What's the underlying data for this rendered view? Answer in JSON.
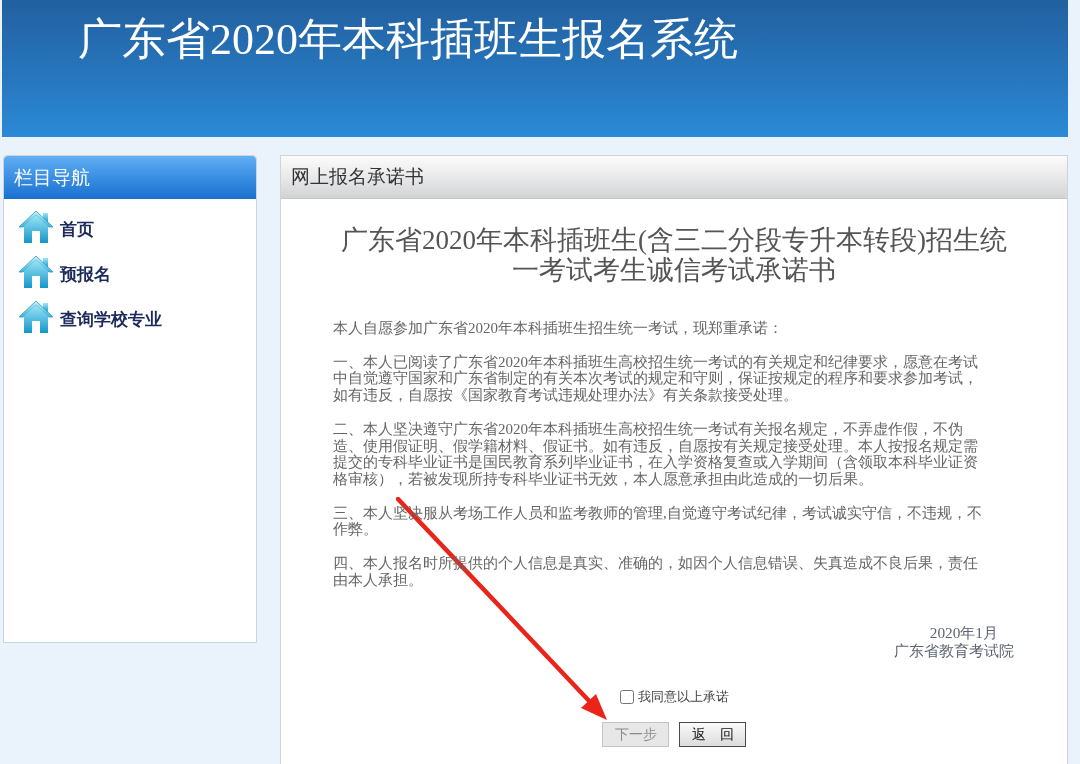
{
  "header": {
    "title": "广东省2020年本科插班生报名系统"
  },
  "sidebar": {
    "title": "栏目导航",
    "items": [
      {
        "label": "首页"
      },
      {
        "label": "预报名"
      },
      {
        "label": "查询学校专业"
      }
    ]
  },
  "panel": {
    "title": "网上报名承诺书",
    "document": {
      "title": "广东省2020年本科插班生(含三二分段专升本转段)招生统一考试考生诚信考试承诺书",
      "intro": "本人自愿参加广东省2020年本科插班生招生统一考试，现郑重承诺：",
      "clauses": [
        "一、本人已阅读了广东省2020年本科插班生高校招生统一考试的有关规定和纪律要求，愿意在考试中自觉遵守国家和广东省制定的有关本次考试的规定和守则，保证按规定的程序和要求参加考试，如有违反，自愿按《国家教育考试违规处理办法》有关条款接受处理。",
        "二、本人坚决遵守广东省2020年本科插班生高校招生统一考试有关报名规定，不弄虚作假，不伪造、使用假证明、假学籍材料、假证书。如有违反，自愿按有关规定接受处理。本人按报名规定需提交的专科毕业证书是国民教育系列毕业证书，在入学资格复查或入学期间（含领取本科毕业证资格审核），若被发现所持专科毕业证书无效，本人愿意承担由此造成的一切后果。",
        "三、本人坚决服从考场工作人员和监考教师的管理,自觉遵守考试纪律，考试诚实守信，不违规，不作弊。",
        "四、本人报名时所提供的个人信息是真实、准确的，如因个人信息错误、失真造成不良后果，责任由本人承担。"
      ],
      "date": "2020年1月",
      "issuer": "广东省教育考试院"
    },
    "agreement": {
      "label": "我同意以上承诺",
      "checked": false
    },
    "buttons": [
      {
        "label": "下一步",
        "disabled": true
      },
      {
        "label": "返　回",
        "disabled": false
      }
    ]
  }
}
